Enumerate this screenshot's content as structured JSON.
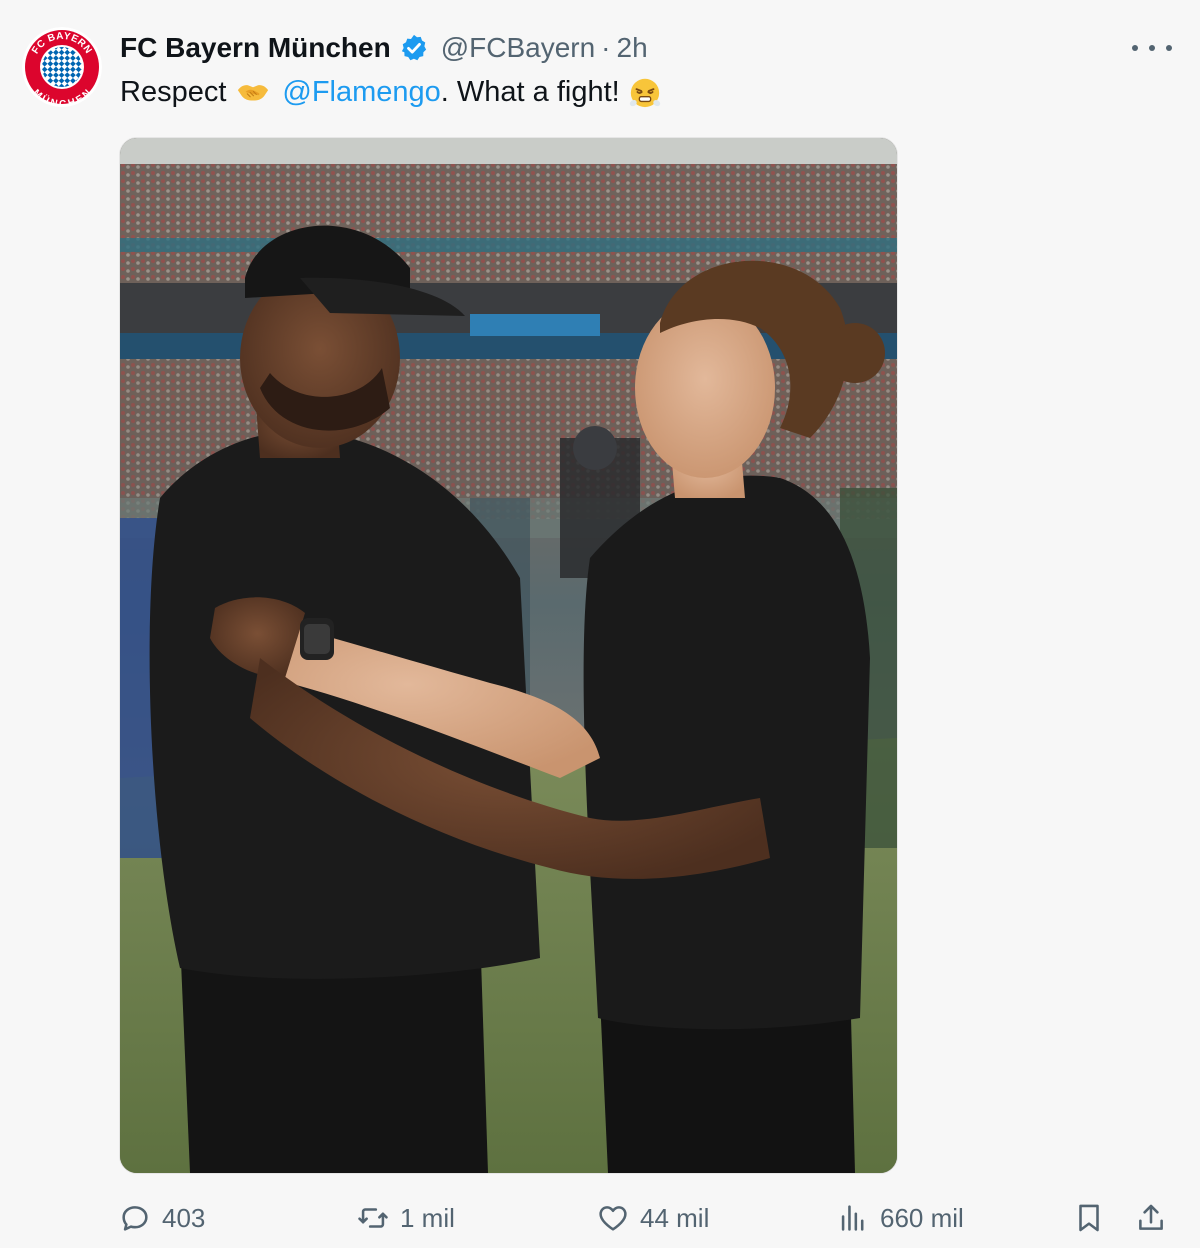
{
  "tweet": {
    "author": {
      "display_name": "FC Bayern München",
      "handle": "@FCBayern",
      "separator": "·",
      "time": "2h",
      "verified": true,
      "avatar_logo_text_top": "FC BAYERN",
      "avatar_logo_text_bottom": "MÜNCHEN"
    },
    "text": {
      "before_mention": "Respect",
      "mention": "@Flamengo",
      "after_mention": ". What a fight!"
    },
    "icons": {
      "more": "more-icon",
      "verified": "verified-badge-icon",
      "emoji_1": "handshake-emoji",
      "emoji_2": "face-with-steam-emoji"
    },
    "media": {
      "kind": "photo",
      "subject": "two coaches in black t-shirts embracing on a stadium pitch"
    },
    "actions": {
      "replies": "403",
      "retweets": "1 mil",
      "likes": "44 mil",
      "views": "660 mil"
    },
    "colors": {
      "accent": "#1d9bf0",
      "muted": "#536471",
      "bayern_red": "#dc052d",
      "bayern_blue": "#0066b2"
    }
  }
}
